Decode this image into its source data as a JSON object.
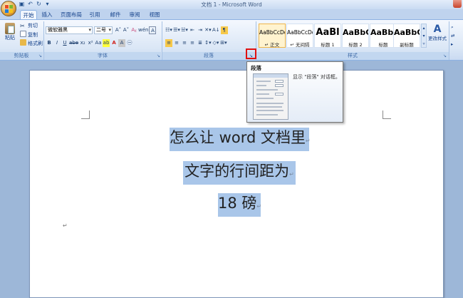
{
  "window": {
    "title": "文档 1 - Microsoft Word"
  },
  "qat": [
    "save-icon",
    "undo-icon",
    "redo-icon",
    "customize-icon"
  ],
  "tabs": [
    {
      "label": "开始",
      "active": true
    },
    {
      "label": "插入"
    },
    {
      "label": "页面布局"
    },
    {
      "label": "引用"
    },
    {
      "label": "邮件"
    },
    {
      "label": "审阅"
    },
    {
      "label": "视图"
    }
  ],
  "clipboard": {
    "paste": "粘贴",
    "cut": "剪切",
    "copy": "复制",
    "format_painter": "格式刷",
    "group_label": "剪贴板"
  },
  "font": {
    "font_name": "微软雅黑",
    "font_size": "二号",
    "group_label": "字体"
  },
  "paragraph": {
    "group_label": "段落"
  },
  "styles": {
    "group_label": "样式",
    "items": [
      {
        "sample": "AaBbCcDd",
        "name": "↵ 正文",
        "selected": true
      },
      {
        "sample": "AaBbCcDd",
        "name": "↵ 无间隔"
      },
      {
        "sample": "AaBl",
        "name": "标题 1"
      },
      {
        "sample": "AaBbC",
        "name": "标题 2"
      },
      {
        "sample": "AaBbC",
        "name": "标题"
      },
      {
        "sample": "AaBbC",
        "name": "副标题"
      }
    ],
    "change_styles": "更改样式"
  },
  "tooltip": {
    "title": "段落",
    "description": "显示 \"段落\" 对话框。"
  },
  "document": {
    "lines": [
      "怎么让 word 文档里",
      "文字的行间距为",
      "18 磅"
    ],
    "pilcrow": "↵"
  },
  "colors": {
    "selection": "#a9c6e9",
    "highlight": "#e01010",
    "ribbon": "#dbe7f6"
  }
}
